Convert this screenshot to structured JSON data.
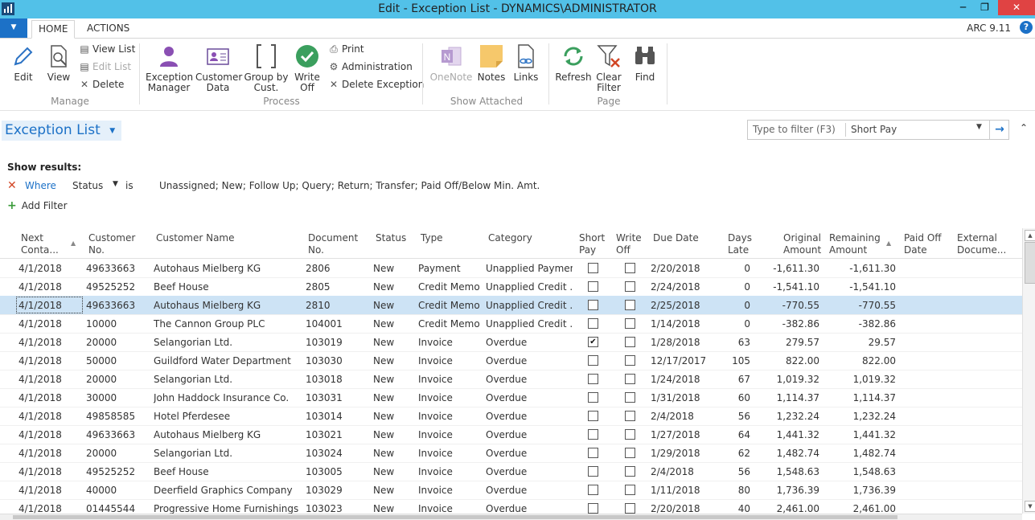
{
  "window": {
    "title": "Edit - Exception List - DYNAMICS\\ADMINISTRATOR"
  },
  "tabs": {
    "home": "HOME",
    "actions": "ACTIONS"
  },
  "version": "ARC 9.11",
  "ribbon": {
    "manage": {
      "edit": "Edit",
      "view": "View",
      "view_list": "View List",
      "edit_list": "Edit List",
      "delete": "Delete",
      "group": "Manage"
    },
    "process": {
      "exception_manager_1": "Exception",
      "exception_manager_2": "Manager",
      "customer_data_1": "Customer",
      "customer_data_2": "Data",
      "group_by_1": "Group by",
      "group_by_2": "Cust.",
      "write_off_1": "Write",
      "write_off_2": "Off",
      "print": "Print",
      "administration": "Administration",
      "delete_exception": "Delete Exception",
      "group": "Process"
    },
    "show_attached": {
      "onenote": "OneNote",
      "notes": "Notes",
      "links": "Links",
      "group": "Show Attached"
    },
    "page": {
      "refresh": "Refresh",
      "clear_filter_1": "Clear",
      "clear_filter_2": "Filter",
      "find": "Find",
      "group": "Page"
    }
  },
  "page": {
    "title": "Exception List",
    "filter_placeholder": "Type to filter (F3)",
    "filter_field": "Short Pay"
  },
  "filters": {
    "show_results": "Show results:",
    "where": "Where",
    "field": "Status",
    "operator": "is",
    "value": "Unassigned; New; Follow Up; Query; Return; Transfer; Paid Off/Below Min. Amt.",
    "add_filter": "Add Filter"
  },
  "columns": [
    {
      "key": "next_contact",
      "line1": "Next",
      "line2": "Conta..."
    },
    {
      "key": "customer_no",
      "line1": "Customer",
      "line2": "No."
    },
    {
      "key": "customer_name",
      "line1": "Customer Name",
      "line2": ""
    },
    {
      "key": "document_no",
      "line1": "Document",
      "line2": "No."
    },
    {
      "key": "status",
      "line1": "Status",
      "line2": ""
    },
    {
      "key": "type",
      "line1": "Type",
      "line2": ""
    },
    {
      "key": "category",
      "line1": "Category",
      "line2": ""
    },
    {
      "key": "short_pay",
      "line1": "Short",
      "line2": "Pay"
    },
    {
      "key": "write_off",
      "line1": "Write",
      "line2": "Off"
    },
    {
      "key": "due_date",
      "line1": "Due Date",
      "line2": ""
    },
    {
      "key": "days_late",
      "line1": "Days",
      "line2": "Late"
    },
    {
      "key": "original_amount",
      "line1": "Original",
      "line2": "Amount"
    },
    {
      "key": "remaining_amount",
      "line1": "Remaining",
      "line2": "Amount"
    },
    {
      "key": "paid_off_date",
      "line1": "Paid Off",
      "line2": "Date"
    },
    {
      "key": "external_doc",
      "line1": "External",
      "line2": "Docume..."
    }
  ],
  "rows": [
    {
      "next_contact": "4/1/2018",
      "customer_no": "49633663",
      "customer_name": "Autohaus Mielberg KG",
      "document_no": "2806",
      "status": "New",
      "type": "Payment",
      "category": "Unapplied Payment",
      "short_pay": false,
      "write_off": false,
      "due_date": "2/20/2018",
      "days_late": "0",
      "original_amount": "-1,611.30",
      "remaining_amount": "-1,611.30",
      "selected": false
    },
    {
      "next_contact": "4/1/2018",
      "customer_no": "49525252",
      "customer_name": "Beef House",
      "document_no": "2805",
      "status": "New",
      "type": "Credit Memo",
      "category": "Unapplied Credit ...",
      "short_pay": false,
      "write_off": false,
      "due_date": "2/24/2018",
      "days_late": "0",
      "original_amount": "-1,541.10",
      "remaining_amount": "-1,541.10",
      "selected": false
    },
    {
      "next_contact": "4/1/2018",
      "customer_no": "49633663",
      "customer_name": "Autohaus Mielberg KG",
      "document_no": "2810",
      "status": "New",
      "type": "Credit Memo",
      "category": "Unapplied Credit ...",
      "short_pay": false,
      "write_off": false,
      "due_date": "2/25/2018",
      "days_late": "0",
      "original_amount": "-770.55",
      "remaining_amount": "-770.55",
      "selected": true
    },
    {
      "next_contact": "4/1/2018",
      "customer_no": "10000",
      "customer_name": "The Cannon Group PLC",
      "document_no": "104001",
      "status": "New",
      "type": "Credit Memo",
      "category": "Unapplied Credit ...",
      "short_pay": false,
      "write_off": false,
      "due_date": "1/14/2018",
      "days_late": "0",
      "original_amount": "-382.86",
      "remaining_amount": "-382.86",
      "selected": false
    },
    {
      "next_contact": "4/1/2018",
      "customer_no": "20000",
      "customer_name": "Selangorian Ltd.",
      "document_no": "103019",
      "status": "New",
      "type": "Invoice",
      "category": "Overdue",
      "short_pay": true,
      "write_off": false,
      "due_date": "1/28/2018",
      "days_late": "63",
      "original_amount": "279.57",
      "remaining_amount": "29.57",
      "selected": false
    },
    {
      "next_contact": "4/1/2018",
      "customer_no": "50000",
      "customer_name": "Guildford Water Department",
      "document_no": "103030",
      "status": "New",
      "type": "Invoice",
      "category": "Overdue",
      "short_pay": false,
      "write_off": false,
      "due_date": "12/17/2017",
      "days_late": "105",
      "original_amount": "822.00",
      "remaining_amount": "822.00",
      "selected": false
    },
    {
      "next_contact": "4/1/2018",
      "customer_no": "20000",
      "customer_name": "Selangorian Ltd.",
      "document_no": "103018",
      "status": "New",
      "type": "Invoice",
      "category": "Overdue",
      "short_pay": false,
      "write_off": false,
      "due_date": "1/24/2018",
      "days_late": "67",
      "original_amount": "1,019.32",
      "remaining_amount": "1,019.32",
      "selected": false
    },
    {
      "next_contact": "4/1/2018",
      "customer_no": "30000",
      "customer_name": "John Haddock Insurance Co.",
      "document_no": "103031",
      "status": "New",
      "type": "Invoice",
      "category": "Overdue",
      "short_pay": false,
      "write_off": false,
      "due_date": "1/31/2018",
      "days_late": "60",
      "original_amount": "1,114.37",
      "remaining_amount": "1,114.37",
      "selected": false
    },
    {
      "next_contact": "4/1/2018",
      "customer_no": "49858585",
      "customer_name": "Hotel Pferdesee",
      "document_no": "103014",
      "status": "New",
      "type": "Invoice",
      "category": "Overdue",
      "short_pay": false,
      "write_off": false,
      "due_date": "2/4/2018",
      "days_late": "56",
      "original_amount": "1,232.24",
      "remaining_amount": "1,232.24",
      "selected": false
    },
    {
      "next_contact": "4/1/2018",
      "customer_no": "49633663",
      "customer_name": "Autohaus Mielberg KG",
      "document_no": "103021",
      "status": "New",
      "type": "Invoice",
      "category": "Overdue",
      "short_pay": false,
      "write_off": false,
      "due_date": "1/27/2018",
      "days_late": "64",
      "original_amount": "1,441.32",
      "remaining_amount": "1,441.32",
      "selected": false
    },
    {
      "next_contact": "4/1/2018",
      "customer_no": "20000",
      "customer_name": "Selangorian Ltd.",
      "document_no": "103024",
      "status": "New",
      "type": "Invoice",
      "category": "Overdue",
      "short_pay": false,
      "write_off": false,
      "due_date": "1/29/2018",
      "days_late": "62",
      "original_amount": "1,482.74",
      "remaining_amount": "1,482.74",
      "selected": false
    },
    {
      "next_contact": "4/1/2018",
      "customer_no": "49525252",
      "customer_name": "Beef House",
      "document_no": "103005",
      "status": "New",
      "type": "Invoice",
      "category": "Overdue",
      "short_pay": false,
      "write_off": false,
      "due_date": "2/4/2018",
      "days_late": "56",
      "original_amount": "1,548.63",
      "remaining_amount": "1,548.63",
      "selected": false
    },
    {
      "next_contact": "4/1/2018",
      "customer_no": "40000",
      "customer_name": "Deerfield Graphics Company",
      "document_no": "103029",
      "status": "New",
      "type": "Invoice",
      "category": "Overdue",
      "short_pay": false,
      "write_off": false,
      "due_date": "1/11/2018",
      "days_late": "80",
      "original_amount": "1,736.39",
      "remaining_amount": "1,736.39",
      "selected": false
    },
    {
      "next_contact": "4/1/2018",
      "customer_no": "01445544",
      "customer_name": "Progressive Home Furnishings",
      "document_no": "103023",
      "status": "New",
      "type": "Invoice",
      "category": "Overdue",
      "short_pay": false,
      "write_off": false,
      "due_date": "2/20/2018",
      "days_late": "40",
      "original_amount": "2,461.00",
      "remaining_amount": "2,461.00",
      "selected": false
    }
  ]
}
